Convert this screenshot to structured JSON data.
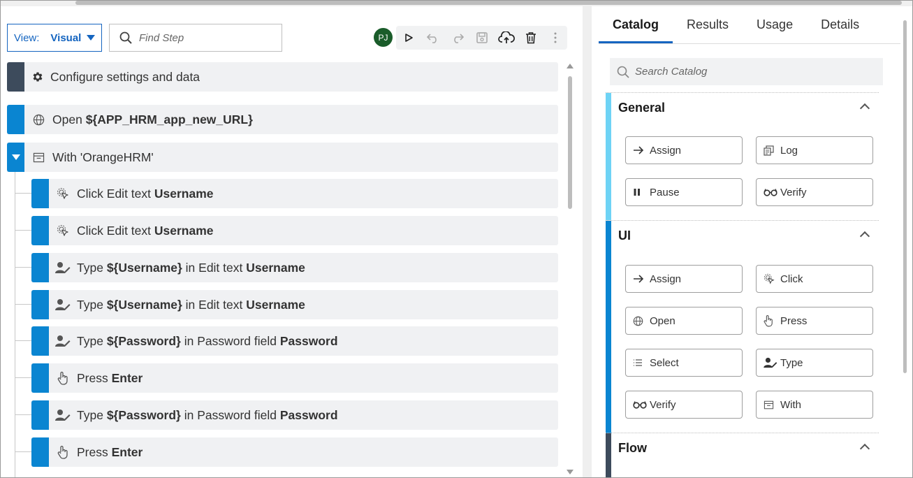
{
  "toolbar": {
    "view_label": "View:",
    "view_value": "Visual",
    "find_placeholder": "Find Step",
    "avatar_initials": "PJ"
  },
  "steps": [
    {
      "pre": "Configure settings and data",
      "bold": "",
      "post": "",
      "post_bold": "",
      "icon": "gear-icon"
    },
    {
      "pre": "Open ",
      "bold": "${APP_HRM_app_new_URL}",
      "post": "",
      "post_bold": "",
      "icon": "globe-icon"
    },
    {
      "pre": "With 'OrangeHRM'",
      "bold": "",
      "post": "",
      "post_bold": "",
      "icon": "window-icon"
    },
    {
      "pre": "Click Edit text ",
      "bold": "Username",
      "post": "",
      "post_bold": "",
      "icon": "click-icon"
    },
    {
      "pre": "Click Edit text ",
      "bold": "Username",
      "post": "",
      "post_bold": "",
      "icon": "click-icon"
    },
    {
      "pre": "Type ",
      "bold": "${Username}",
      "post": " in Edit text ",
      "post_bold": "Username",
      "icon": "type-user-icon"
    },
    {
      "pre": "Type ",
      "bold": "${Username}",
      "post": " in Edit text ",
      "post_bold": "Username",
      "icon": "type-user-icon"
    },
    {
      "pre": "Type ",
      "bold": "${Password}",
      "post": " in Password field ",
      "post_bold": "Password",
      "icon": "type-user-icon"
    },
    {
      "pre": "Press ",
      "bold": "Enter",
      "post": "",
      "post_bold": "",
      "icon": "press-icon"
    },
    {
      "pre": "Type ",
      "bold": "${Password}",
      "post": " in Password field ",
      "post_bold": "Password",
      "icon": "type-user-icon"
    },
    {
      "pre": "Press ",
      "bold": "Enter",
      "post": "",
      "post_bold": "",
      "icon": "press-icon"
    }
  ],
  "tabs": [
    "Catalog",
    "Results",
    "Usage",
    "Details"
  ],
  "catalog": {
    "search_placeholder": "Search Catalog",
    "sections": [
      {
        "title": "General",
        "color": "#6ed3f5",
        "items": [
          "Assign",
          "Log",
          "Pause",
          "Verify"
        ]
      },
      {
        "title": "UI",
        "color": "#0a85d1",
        "items": [
          "Assign",
          "Click",
          "Open",
          "Press",
          "Select",
          "Type",
          "Verify",
          "With"
        ]
      },
      {
        "title": "Flow",
        "color": "#3d4b5c",
        "items": []
      }
    ]
  },
  "colors": {
    "accent": "#1565c0",
    "step_blue": "#0a85d1",
    "step_dark": "#3d4b5c",
    "general": "#6ed3f5"
  }
}
